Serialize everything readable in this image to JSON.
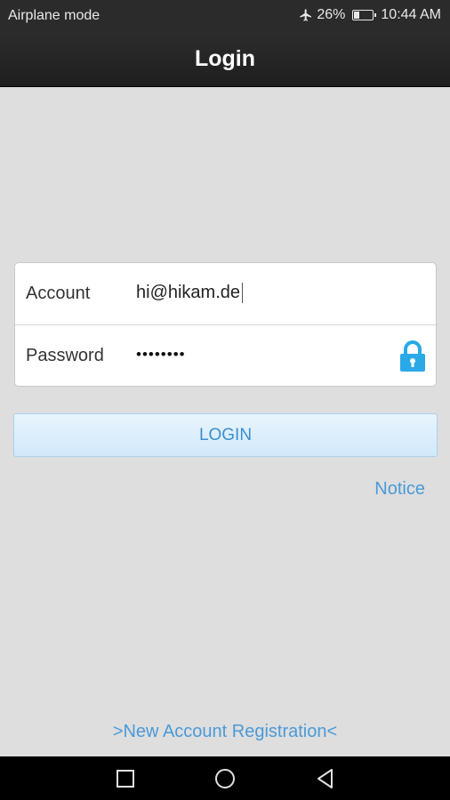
{
  "status_bar": {
    "left_text": "Airplane mode",
    "airplane_icon": "airplane-icon",
    "battery_percent": "26%",
    "battery_level": 0.26,
    "battery_icon": "battery-icon",
    "time": "10:44 AM"
  },
  "header": {
    "title": "Login"
  },
  "form": {
    "account_label": "Account",
    "account_value": "hi@hikam.de",
    "password_label": "Password",
    "password_value": "••••••••",
    "lock_icon": "lock-icon"
  },
  "actions": {
    "login_label": "LOGIN",
    "notice_label": "Notice",
    "register_label": ">New Account Registration<"
  },
  "nav_bar": {
    "icons": [
      "recents-icon",
      "home-icon",
      "back-icon"
    ]
  },
  "colors": {
    "accent": "#4a9ad8",
    "lock": "#29a9e6",
    "background": "#dedede",
    "header": "#222222"
  }
}
